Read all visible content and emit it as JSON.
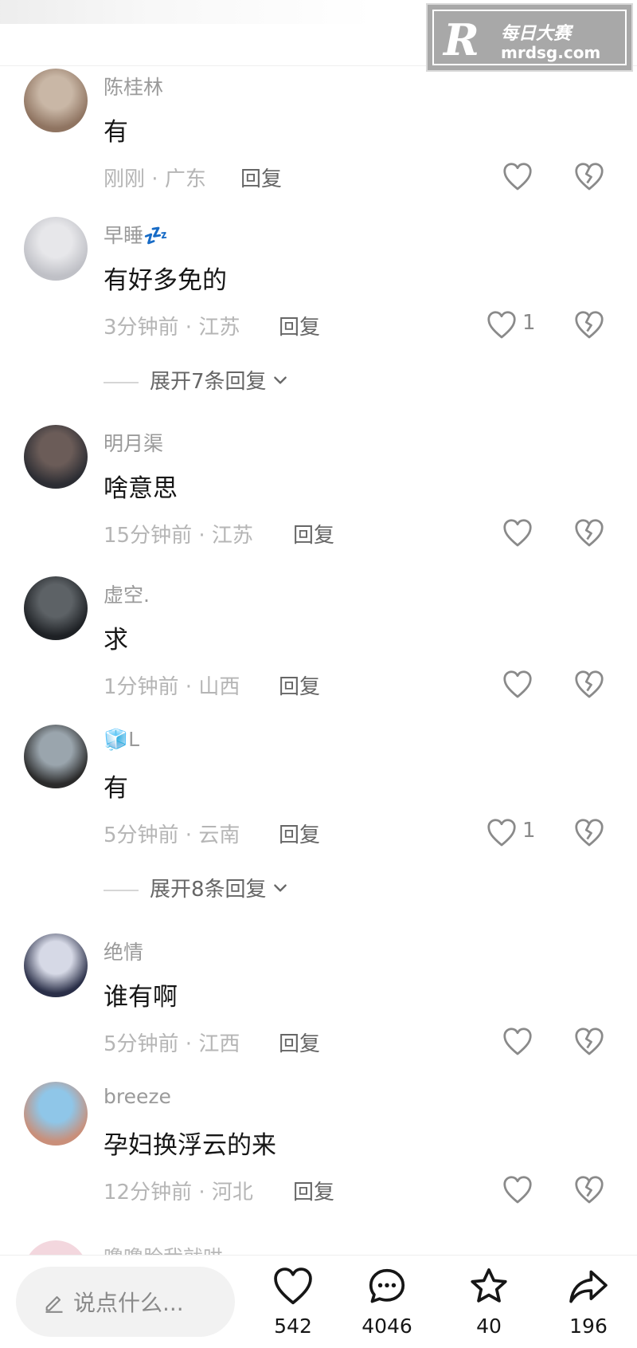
{
  "watermark": {
    "logo": "R",
    "cn": "每日大赛",
    "url": "mrdsg.com"
  },
  "comments": [
    {
      "user": "陈桂林",
      "text": "有",
      "time": "刚刚",
      "location": "广东",
      "reply": "回复",
      "likes": "",
      "avatar_colors": [
        "#c9b7a6",
        "#8f7461"
      ]
    },
    {
      "user": "早睡💤",
      "text": "有好多免的",
      "time": "3分钟前",
      "location": "江苏",
      "reply": "回复",
      "likes": "1",
      "expand": "展开7条回复",
      "avatar_colors": [
        "#e7e7ea",
        "#bfc0c6"
      ]
    },
    {
      "user": "明月渠",
      "text": "啥意思",
      "time": "15分钟前",
      "location": "江苏",
      "reply": "回复",
      "likes": "",
      "avatar_colors": [
        "#6b5c58",
        "#2c2d33"
      ]
    },
    {
      "user": "虚空.",
      "text": "求",
      "time": "1分钟前",
      "location": "山西",
      "reply": "回复",
      "likes": "",
      "avatar_colors": [
        "#5d6266",
        "#1e2125"
      ]
    },
    {
      "user": "🧊L",
      "text": "有",
      "time": "5分钟前",
      "location": "云南",
      "reply": "回复",
      "likes": "1",
      "expand": "展开8条回复",
      "avatar_colors": [
        "#9aa5ad",
        "#2b2b2b"
      ]
    },
    {
      "user": "绝情",
      "text": "谁有啊",
      "time": "5分钟前",
      "location": "江西",
      "reply": "回复",
      "likes": "",
      "avatar_colors": [
        "#d6d9e6",
        "#2a2f48"
      ]
    },
    {
      "user": "breeze",
      "text": "孕妇换浮云的来",
      "time": "12分钟前",
      "location": "河北",
      "reply": "回复",
      "likes": "",
      "avatar_colors": [
        "#8fc6e8",
        "#c98f7a"
      ]
    }
  ],
  "partial_comment": {
    "user": "噜噜脸我就哄"
  },
  "bottom_bar": {
    "input_placeholder": "说点什么...",
    "likes": "542",
    "comments": "4046",
    "favorites": "40",
    "shares": "196"
  }
}
